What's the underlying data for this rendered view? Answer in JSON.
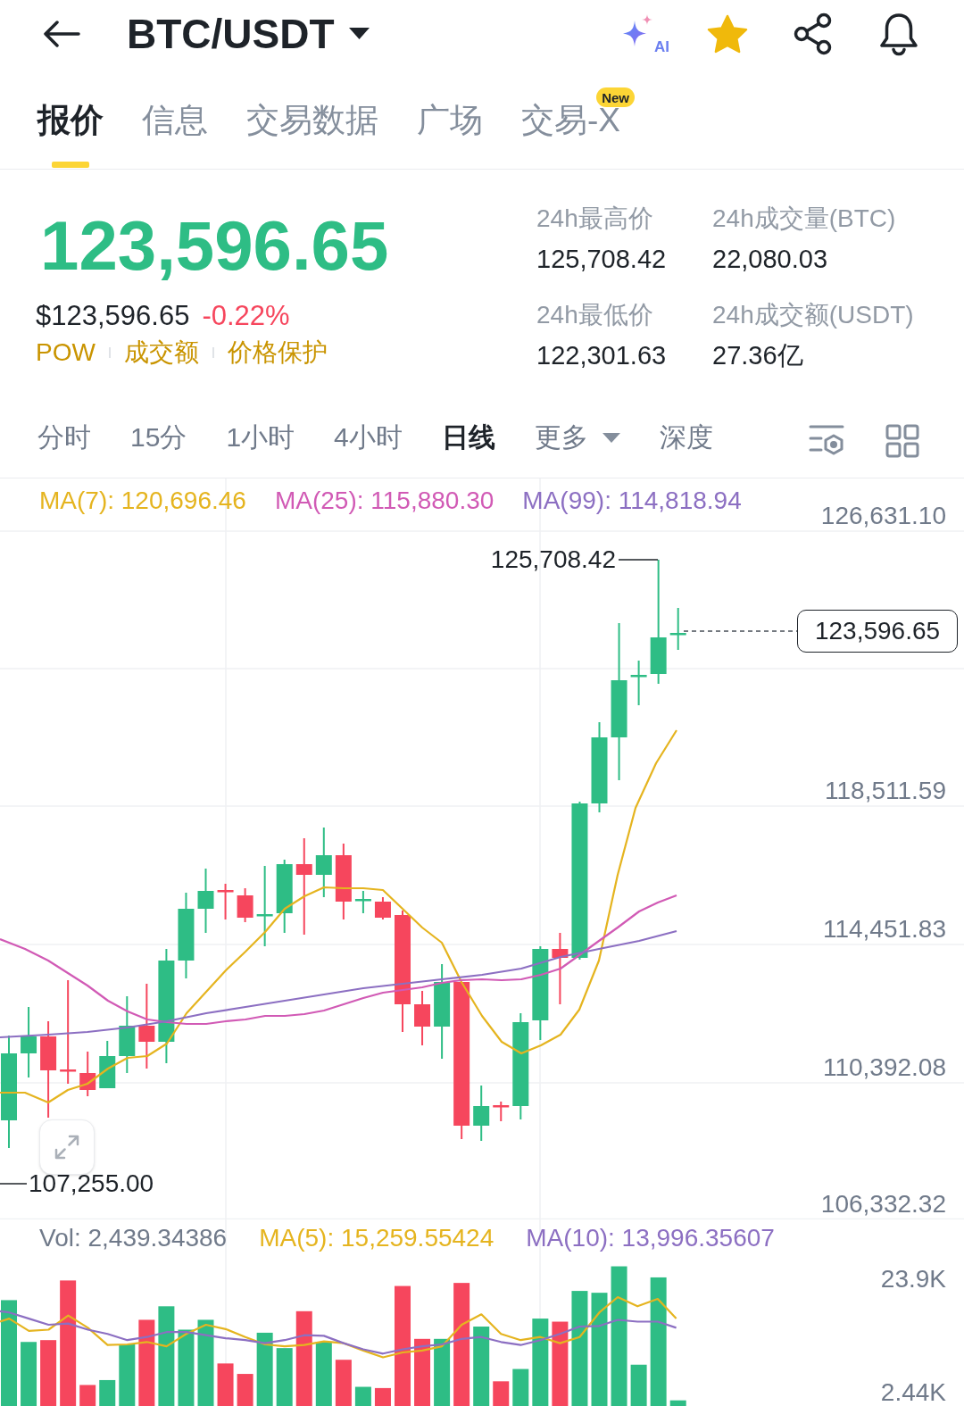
{
  "header": {
    "pair": "BTC/USDT",
    "ai_label": "AI",
    "favorite": true
  },
  "tabs": [
    {
      "label": "报价",
      "selected": true
    },
    {
      "label": "信息",
      "selected": false
    },
    {
      "label": "交易数据",
      "selected": false
    },
    {
      "label": "广场",
      "selected": false
    },
    {
      "label": "交易-X",
      "selected": false,
      "badge": "New"
    }
  ],
  "ticker": {
    "price": "123,596.65",
    "price_usd": "$123,596.65",
    "change": "-0.22%",
    "tags": [
      "POW",
      "成交额",
      "价格保护"
    ],
    "stats": [
      {
        "label": "24h最高价",
        "value": "125,708.42"
      },
      {
        "label": "24h成交量(BTC)",
        "value": "22,080.03"
      },
      {
        "label": "24h最低价",
        "value": "122,301.63"
      },
      {
        "label": "24h成交额(USDT)",
        "value": "27.36亿"
      }
    ]
  },
  "intervals": [
    {
      "label": "分时",
      "selected": false,
      "dropdown": false
    },
    {
      "label": "15分",
      "selected": false,
      "dropdown": false
    },
    {
      "label": "1小时",
      "selected": false,
      "dropdown": false
    },
    {
      "label": "4小时",
      "selected": false,
      "dropdown": false
    },
    {
      "label": "日线",
      "selected": true,
      "dropdown": false
    },
    {
      "label": "更多",
      "selected": false,
      "dropdown": true
    },
    {
      "label": "深度",
      "selected": false,
      "dropdown": false
    }
  ],
  "chart": {
    "indicators": [
      {
        "label": "MA(7): 120,696.46",
        "color": "#e5b41f"
      },
      {
        "label": "MA(25): 115,880.30",
        "color": "#d15ab5"
      },
      {
        "label": "MA(99): 114,818.94",
        "color": "#8c6fc2"
      }
    ],
    "price_axis": [
      "126,631.10",
      "118,511.59",
      "114,451.83",
      "110,392.08",
      "106,332.32"
    ],
    "high_label": "125,708.42",
    "low_label": "107,255.00",
    "last_price": "123,596.65"
  },
  "volume": {
    "indicators": [
      {
        "label": "Vol: 2,439.34386",
        "color": "#707a8a"
      },
      {
        "label": "MA(5): 15,259.55424",
        "color": "#e5b41f"
      },
      {
        "label": "MA(10): 13,996.35607",
        "color": "#8c6fc2"
      }
    ],
    "axis": [
      "23.9K",
      "2.44K"
    ]
  }
}
